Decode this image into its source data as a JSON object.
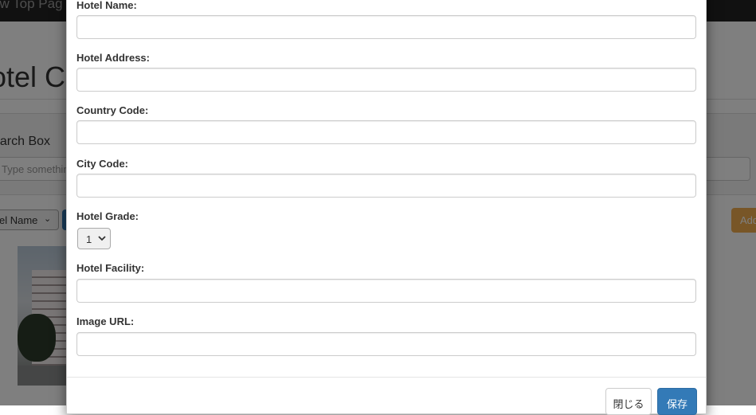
{
  "background": {
    "navbar_brand": "ow Top Pag",
    "page_heading": "otel C",
    "search_box_title": "earch Box",
    "search_placeholder": "Type something",
    "sort_select_value": "el Name",
    "add_button_label": "Add"
  },
  "modal": {
    "fields": [
      {
        "label": "Hotel Name:",
        "value": ""
      },
      {
        "label": "Hotel Address:",
        "value": ""
      },
      {
        "label": "Country Code:",
        "value": ""
      },
      {
        "label": "City Code:",
        "value": ""
      },
      {
        "label": "Hotel Grade:",
        "value": "1"
      },
      {
        "label": "Hotel Facility:",
        "value": ""
      },
      {
        "label": "Image URL:",
        "value": ""
      }
    ],
    "close_label": "閉じる",
    "save_label": "保存"
  },
  "colors": {
    "primary": "#337ab7",
    "warning": "#f0ad4e",
    "navbar": "#222222",
    "backdrop": "rgba(0,0,0,0.5)"
  }
}
